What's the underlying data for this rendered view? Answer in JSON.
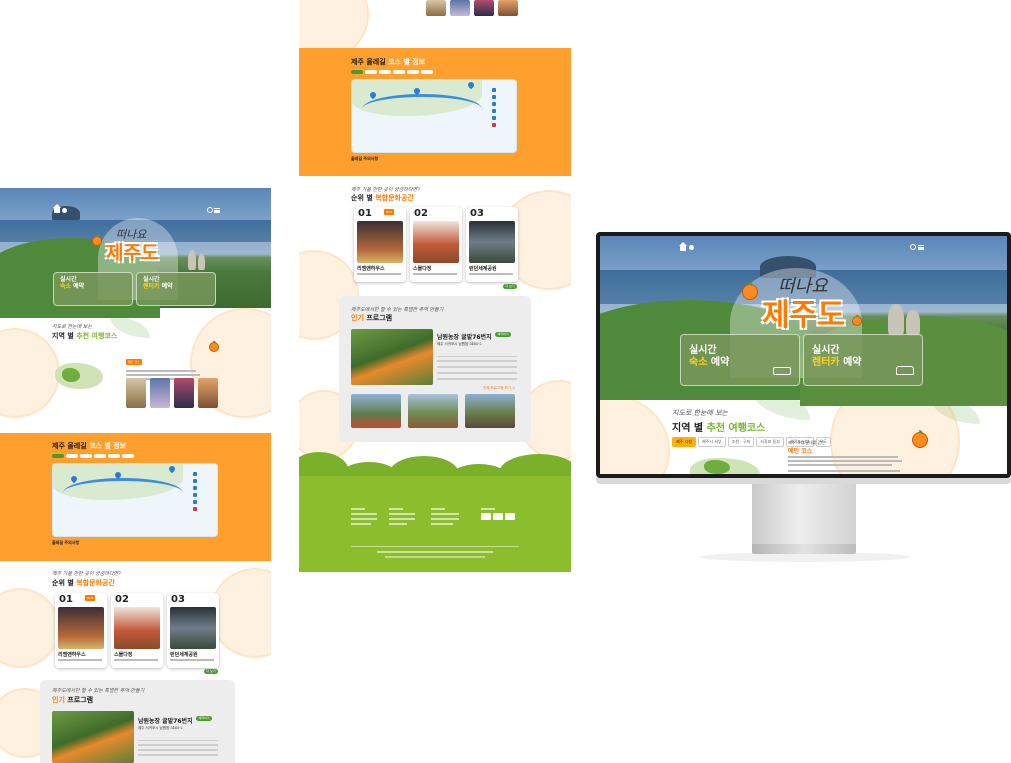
{
  "hero": {
    "subtitle": "떠나요",
    "title": "제주도"
  },
  "booking": {
    "stay_line1": "실시간",
    "stay_highlight": "숙소",
    "stay_suffix": "예약",
    "car_line1": "실시간",
    "car_highlight": "렌터카",
    "car_suffix": "예약"
  },
  "region_section": {
    "script": "지도로 한눈에 보는",
    "title_prefix": "지역 별",
    "title_highlight": "추천 여행코스",
    "tabs": [
      "제주 시청",
      "제주시 서부",
      "조천 · 구좌",
      "서귀포 동부",
      "서귀포 남부",
      "우도"
    ],
    "info_title": "메인 코스",
    "info_caption": "제주 시청 일대를 걷는"
  },
  "trail_section": {
    "title_prefix": "제주 올레길",
    "title_highlight": "코스 별 정보",
    "legend": [
      "시작점",
      "종점",
      "올레 안내소",
      "화장실",
      "편의점",
      "주차장",
      "음식점",
      "버스정류장"
    ],
    "note_title": "올레길 주의사항"
  },
  "culture_section": {
    "script": "제주 가볼 만한 곳이 궁금하다면?",
    "title_prefix": "순위 별",
    "title_highlight": "복합문화공간",
    "cards": [
      {
        "num": "01",
        "name": "리엠앤하우스"
      },
      {
        "num": "02",
        "name": "스몰다정"
      },
      {
        "num": "03",
        "name": "런던세계공원"
      }
    ],
    "badge": "HOT",
    "more": "더 보기"
  },
  "program_section": {
    "script": "제주도에서만 할 수 있는 특별한 추억 만들기",
    "title_highlight": "인기",
    "title_suffix": "프로그램",
    "name": "남원농장 귤밭76번지",
    "badge": "예약하기",
    "address": "제주 서귀포시 남원읍 5485-2",
    "more_link": "전체 프로그램 보기 >"
  },
  "colors": {
    "orange": "#ff9f2e",
    "accent_orange": "#ff7a00",
    "green": "#4a9b2f",
    "grass": "#8bbd2c",
    "yellow_tab": "#ffb000"
  },
  "icons": [
    "home-icon",
    "user-icon",
    "search-icon",
    "menu-icon",
    "bed-icon",
    "car-icon",
    "map-pin-icon"
  ]
}
